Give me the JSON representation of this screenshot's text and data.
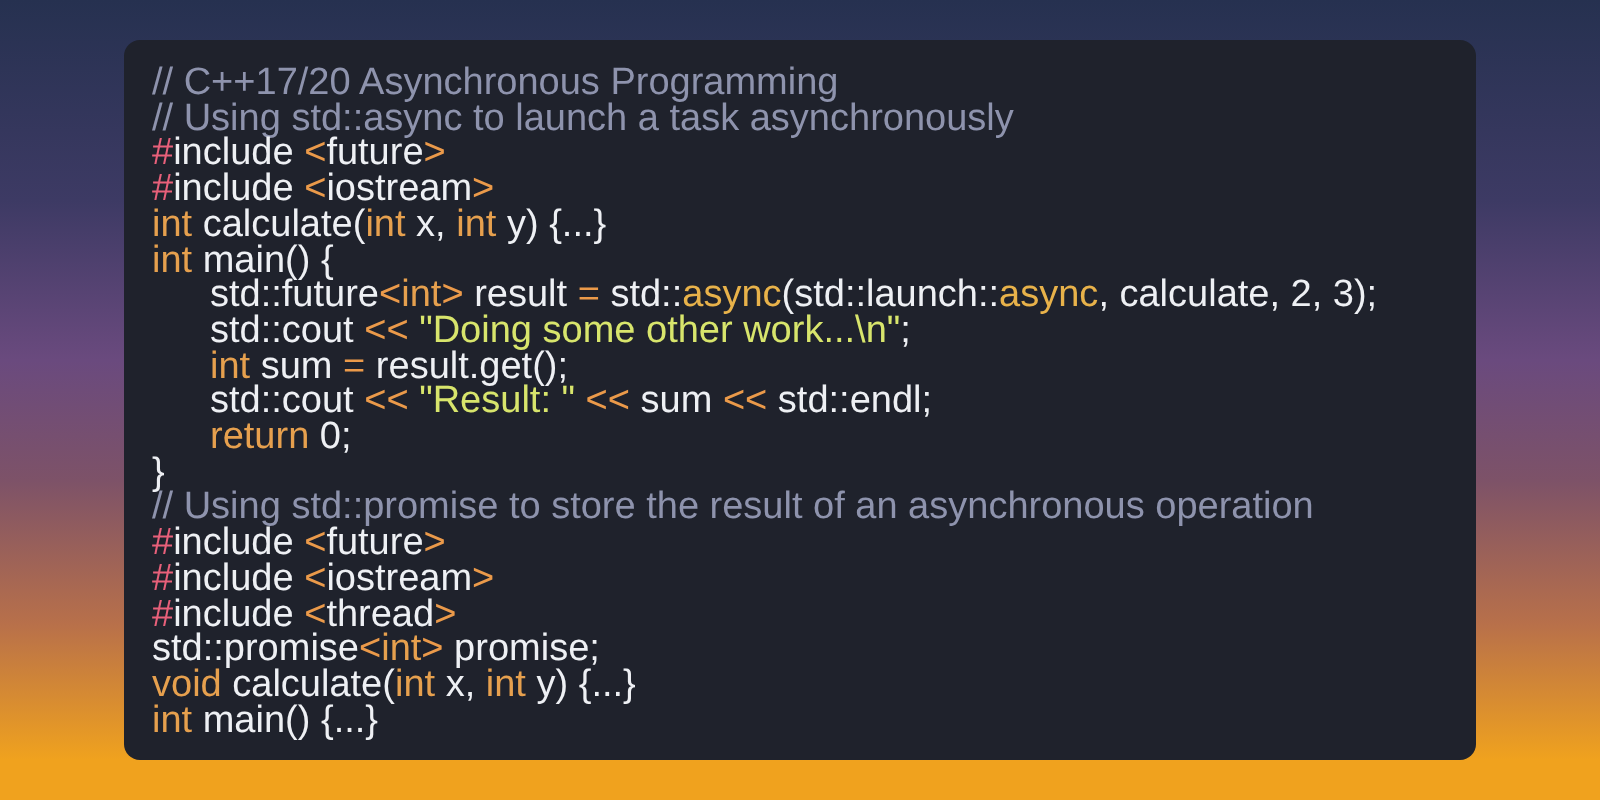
{
  "code_lines": [
    {
      "tokens": [
        {
          "kind": "comment",
          "text": "// C++17/20 Asynchronous Programming"
        }
      ]
    },
    {
      "tokens": [
        {
          "kind": "comment",
          "text": "// Using std::async to launch a task asynchronously"
        }
      ]
    },
    {
      "tokens": [
        {
          "kind": "hash",
          "text": "#"
        },
        {
          "kind": "plain",
          "text": "include "
        },
        {
          "kind": "punct",
          "text": "<"
        },
        {
          "kind": "plain",
          "text": "future"
        },
        {
          "kind": "punct",
          "text": ">"
        }
      ]
    },
    {
      "tokens": [
        {
          "kind": "hash",
          "text": "#"
        },
        {
          "kind": "plain",
          "text": "include "
        },
        {
          "kind": "punct",
          "text": "<"
        },
        {
          "kind": "plain",
          "text": "iostream"
        },
        {
          "kind": "punct",
          "text": ">"
        }
      ]
    },
    {
      "tokens": [
        {
          "kind": "keyword",
          "text": "int"
        },
        {
          "kind": "plain",
          "text": " calculate("
        },
        {
          "kind": "keyword",
          "text": "int"
        },
        {
          "kind": "plain",
          "text": " x, "
        },
        {
          "kind": "keyword",
          "text": "int"
        },
        {
          "kind": "plain",
          "text": " y) {...}"
        }
      ]
    },
    {
      "tokens": [
        {
          "kind": "keyword",
          "text": "int"
        },
        {
          "kind": "plain",
          "text": " main() {"
        }
      ],
      "children": [
        {
          "tokens": [
            {
              "kind": "plain",
              "text": "std::future"
            },
            {
              "kind": "punct",
              "text": "<"
            },
            {
              "kind": "keyword",
              "text": "int"
            },
            {
              "kind": "punct",
              "text": ">"
            },
            {
              "kind": "plain",
              "text": " result "
            },
            {
              "kind": "punct",
              "text": "="
            },
            {
              "kind": "plain",
              "text": " std::"
            },
            {
              "kind": "function",
              "text": "async"
            },
            {
              "kind": "plain",
              "text": "(std::launch::"
            },
            {
              "kind": "function",
              "text": "async"
            },
            {
              "kind": "plain",
              "text": ", calculate, 2, 3);"
            }
          ]
        },
        {
          "tokens": [
            {
              "kind": "plain",
              "text": "std::cout "
            },
            {
              "kind": "punct",
              "text": "<<"
            },
            {
              "kind": "string",
              "text": " \"Doing some other work...\\n\""
            },
            {
              "kind": "plain",
              "text": ";"
            }
          ]
        },
        {
          "tokens": [
            {
              "kind": "keyword",
              "text": "int"
            },
            {
              "kind": "plain",
              "text": " sum "
            },
            {
              "kind": "punct",
              "text": "="
            },
            {
              "kind": "plain",
              "text": " result.get();"
            }
          ]
        },
        {
          "tokens": [
            {
              "kind": "plain",
              "text": "std::cout "
            },
            {
              "kind": "punct",
              "text": "<<"
            },
            {
              "kind": "string",
              "text": " \"Result: \""
            },
            {
              "kind": "punct",
              "text": " <<"
            },
            {
              "kind": "plain",
              "text": " sum "
            },
            {
              "kind": "punct",
              "text": "<<"
            },
            {
              "kind": "plain",
              "text": " std::endl;"
            }
          ]
        },
        {
          "tokens": [
            {
              "kind": "keyword",
              "text": "return"
            },
            {
              "kind": "plain",
              "text": " 0;"
            }
          ]
        }
      ]
    },
    {
      "tokens": [
        {
          "kind": "plain",
          "text": "}"
        }
      ]
    },
    {
      "tokens": [
        {
          "kind": "comment",
          "text": "// Using std::promise to store the result of an asynchronous operation"
        }
      ]
    },
    {
      "tokens": [
        {
          "kind": "hash",
          "text": "#"
        },
        {
          "kind": "plain",
          "text": "include "
        },
        {
          "kind": "punct",
          "text": "<"
        },
        {
          "kind": "plain",
          "text": "future"
        },
        {
          "kind": "punct",
          "text": ">"
        }
      ]
    },
    {
      "tokens": [
        {
          "kind": "hash",
          "text": "#"
        },
        {
          "kind": "plain",
          "text": "include "
        },
        {
          "kind": "punct",
          "text": "<"
        },
        {
          "kind": "plain",
          "text": "iostream"
        },
        {
          "kind": "punct",
          "text": ">"
        }
      ]
    },
    {
      "tokens": [
        {
          "kind": "hash",
          "text": "#"
        },
        {
          "kind": "plain",
          "text": "include "
        },
        {
          "kind": "punct",
          "text": "<"
        },
        {
          "kind": "plain",
          "text": "thread"
        },
        {
          "kind": "punct",
          "text": ">"
        }
      ]
    },
    {
      "tokens": [
        {
          "kind": "plain",
          "text": "std::promise"
        },
        {
          "kind": "punct",
          "text": "<"
        },
        {
          "kind": "keyword",
          "text": "int"
        },
        {
          "kind": "punct",
          "text": ">"
        },
        {
          "kind": "plain",
          "text": " promise;"
        }
      ]
    },
    {
      "tokens": [
        {
          "kind": "keyword",
          "text": "void"
        },
        {
          "kind": "plain",
          "text": " calculate("
        },
        {
          "kind": "keyword",
          "text": "int"
        },
        {
          "kind": "plain",
          "text": " x, "
        },
        {
          "kind": "keyword",
          "text": "int"
        },
        {
          "kind": "plain",
          "text": " y) {...}"
        }
      ]
    },
    {
      "tokens": [
        {
          "kind": "keyword",
          "text": "int"
        },
        {
          "kind": "plain",
          "text": " main() {...}"
        }
      ]
    }
  ]
}
